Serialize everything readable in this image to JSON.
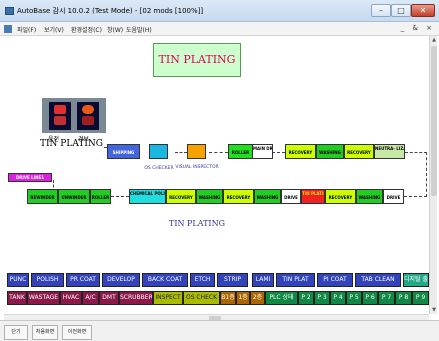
{
  "window": {
    "title": "AutoBase 감시 10.0.2 (Test Mode) - [02 mods [100%]]"
  },
  "menu": {
    "items": [
      "파일(F)",
      "보기(V)",
      "환경설정(C)",
      "창(W)",
      "도움말(H)"
    ],
    "mdi_controls": "_ & ×"
  },
  "diagram": {
    "title": "TIN PLATING",
    "signal_run": "운전",
    "signal_alarm": "경보",
    "left_label": "TIN PLATING",
    "bottom_label": "TIN PLATING",
    "indicator": "DRIVE LINE1",
    "captions": {
      "os_checker": "OS CHECKER",
      "visual_inspector": "VISUAL INSPECTOR"
    },
    "top_row": [
      {
        "label": "SHIPPING"
      },
      {
        "label": "ROLLER"
      },
      {
        "label": "MAIN DRIVE"
      },
      {
        "label": "RECOVERY"
      },
      {
        "label": "WASHING"
      },
      {
        "label": "RECOVERY"
      },
      {
        "label": "NEUTRA- LIZATION"
      }
    ],
    "bottom_row": [
      {
        "label": "REWINDER"
      },
      {
        "label": "UNWINDER"
      },
      {
        "label": "ROLLER"
      },
      {
        "label": "CHEMICAL POLISHING"
      },
      {
        "label": "RECOVERY"
      },
      {
        "label": "WASHING"
      },
      {
        "label": "RECOVERY"
      },
      {
        "label": "WASHING"
      },
      {
        "label": "DRIVE"
      },
      {
        "label": "TIN PLATING"
      },
      {
        "label": "RECOVERY"
      },
      {
        "label": "WASHING"
      },
      {
        "label": "DRIVE"
      }
    ]
  },
  "panel": {
    "row1": [
      "PUNC",
      "POLISH",
      "PR COAT",
      "DEVELOP",
      "BACK COAT",
      "ETCH",
      "STRIP",
      "LAMI",
      "TIN PLAT",
      "PI COAT",
      "TAB CLEAN",
      "디지털 출력"
    ],
    "row2": [
      "TANK",
      "WASTAGE",
      "HVAC",
      "A/C",
      "DMT",
      "SCRUBBER",
      "INSPECT",
      "OS CHECK",
      "B1층",
      "1층",
      "2층",
      "PLC 상태",
      "P 2",
      "P 3",
      "P 4",
      "P 5",
      "P 6",
      "P 7",
      "P 8",
      "P 9"
    ]
  },
  "tabs": [
    "단기",
    "처음화면",
    "이전화면"
  ],
  "colors": {
    "row1_bg": "#3344bb",
    "row2_bg": "#8b1a4a",
    "title_text": "#e00060",
    "title_box": "#ccffcc"
  }
}
